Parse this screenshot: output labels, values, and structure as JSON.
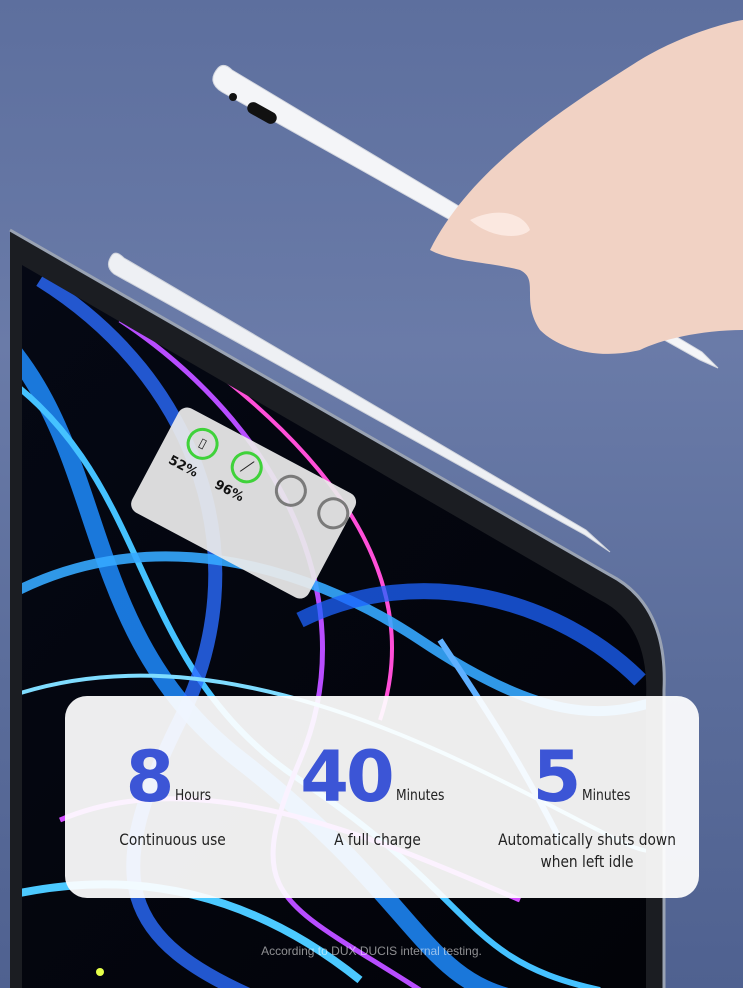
{
  "pencil": {
    "badge_text": "96"
  },
  "widget": {
    "tablet_percent": "52%",
    "pencil_percent": "96%",
    "colors": {
      "charged_ring": "#3fd23a",
      "empty_ring": "#7a7a7a"
    }
  },
  "stats": [
    {
      "number": "8",
      "unit": "Hours",
      "description": "Continuous use"
    },
    {
      "number": "40",
      "unit": "Minutes",
      "description": "A full charge"
    },
    {
      "number": "5",
      "unit": "Minutes",
      "description": "Automatically shuts down when left idle"
    }
  ],
  "footnote": "According to DUX DUCIS internal testing.",
  "colors": {
    "accent": "#3c55d6",
    "background": "#5d6f9e"
  }
}
